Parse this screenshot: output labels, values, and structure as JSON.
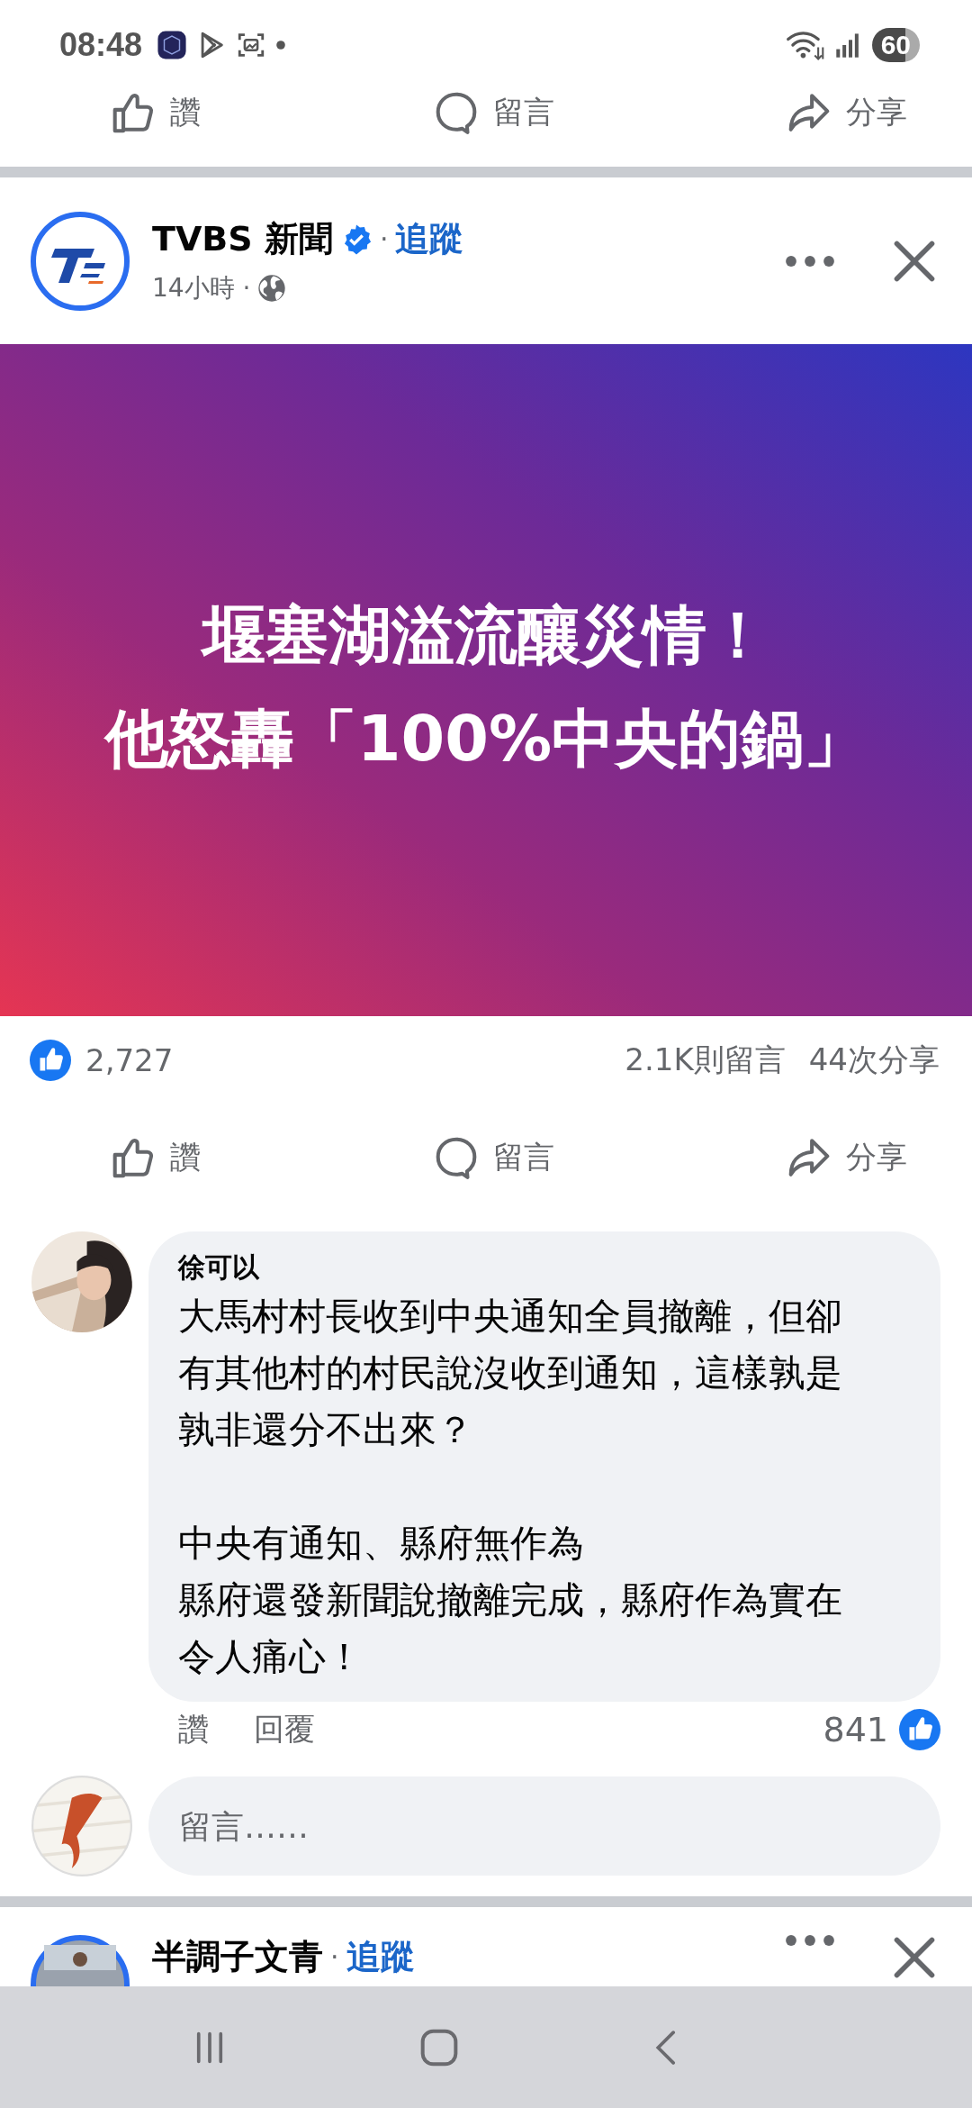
{
  "status_bar": {
    "time": "08:48",
    "battery": "60"
  },
  "previous_post_actions": [
    {
      "kind": "like",
      "label": "讚"
    },
    {
      "kind": "comment",
      "label": "留言"
    },
    {
      "kind": "share",
      "label": "分享"
    }
  ],
  "post": {
    "author": "TVBS 新聞",
    "verified": true,
    "separator": "·",
    "follow": "追蹤",
    "time": "14小時 ·",
    "headline": [
      "堰塞湖溢流釀災情！",
      "他怒轟「100%中央的鍋」"
    ],
    "reactions": "2,727",
    "comments": "2.1K則留言",
    "shares": "44次分享",
    "actions": [
      {
        "kind": "like",
        "label": "讚"
      },
      {
        "kind": "comment",
        "label": "留言"
      },
      {
        "kind": "share",
        "label": "分享"
      }
    ],
    "top_comment": {
      "author": "徐可以",
      "paragraphs": [
        [
          "大馬村村長收到中央通知全員撤離，但卻有其他村的村民說沒收到通知，這樣孰是孰非還分不出來？"
        ],
        [
          "中央有通知、縣府無作為",
          "縣府還發新聞說撤離完成，縣府作為實在令人痛心！"
        ]
      ],
      "like": "讚",
      "reply": "回覆",
      "likes": "841"
    },
    "comment_field": {
      "placeholder": "留言……"
    }
  },
  "next_post": {
    "author": "半調子文青",
    "separator": "·",
    "follow": "追蹤"
  }
}
